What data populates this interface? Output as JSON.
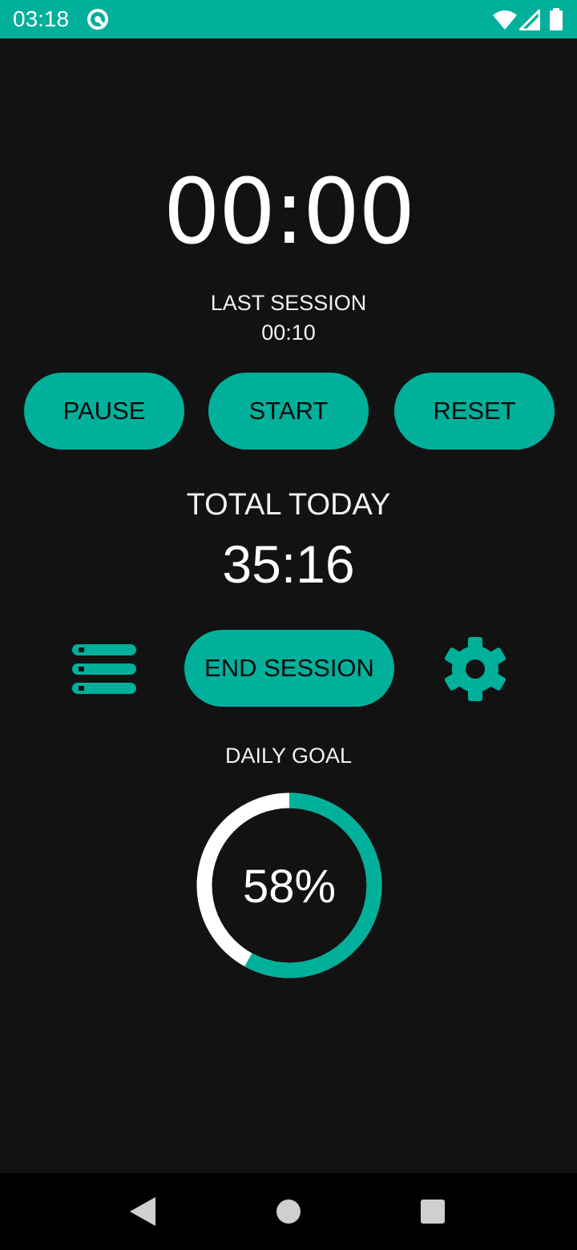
{
  "status_bar": {
    "time": "03:18",
    "app_icon": "sync-circle-icon",
    "wifi_icon": "wifi-icon",
    "signal_icon": "cell-signal-icon",
    "battery_icon": "battery-icon",
    "color": "#00b09b"
  },
  "timer": {
    "display": "00:00"
  },
  "last_session": {
    "label": "LAST SESSION",
    "value": "00:10"
  },
  "controls": {
    "pause_label": "PAUSE",
    "start_label": "START",
    "reset_label": "RESET"
  },
  "total_today": {
    "label": "TOTAL TODAY",
    "value": "35:16"
  },
  "actions": {
    "list_icon": "list-icon",
    "end_session_label": "END SESSION",
    "settings_icon": "gear-icon"
  },
  "daily_goal": {
    "label": "DAILY GOAL",
    "percent_text": "58%",
    "progress": 0.58,
    "progress_color": "#00b09b",
    "track_color": "#ffffff"
  },
  "nav_bar": {
    "back_icon": "back-triangle-icon",
    "home_icon": "home-circle-icon",
    "recents_icon": "recents-square-icon"
  },
  "colors": {
    "accent": "#00b09b",
    "background": "#121212"
  }
}
